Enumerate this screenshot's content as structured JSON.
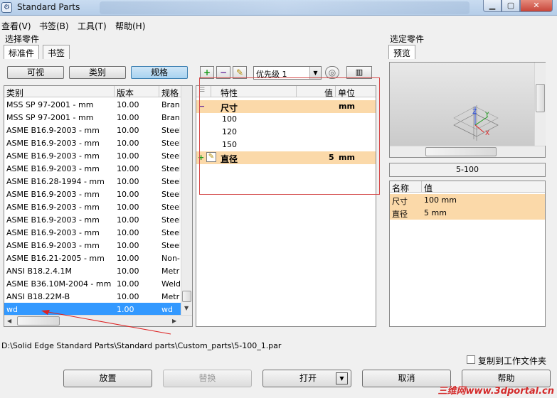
{
  "window": {
    "title": "Standard Parts",
    "controls": {
      "minimize": "▁",
      "maximize": "▢",
      "close": "✕"
    }
  },
  "menu": [
    "查看(V)",
    "书签(B)",
    "工具(T)",
    "帮助(H)"
  ],
  "left": {
    "section_label": "选择零件",
    "tabs": [
      "标准件",
      "书签"
    ],
    "filter_buttons": [
      "可视",
      "类别",
      "规格"
    ],
    "columns": [
      "类别",
      "版本",
      "规格"
    ],
    "rows": [
      [
        "MSS SP 97-2001 - mm",
        "10.00",
        "Branc"
      ],
      [
        "MSS SP 97-2001 - mm",
        "10.00",
        "Branc"
      ],
      [
        "ASME B16.9-2003 - mm",
        "10.00",
        "Steel"
      ],
      [
        "ASME B16.9-2003 - mm",
        "10.00",
        "Steel"
      ],
      [
        "ASME B16.9-2003 - mm",
        "10.00",
        "Steel"
      ],
      [
        "ASME B16.9-2003 - mm",
        "10.00",
        "Steel"
      ],
      [
        "ASME B16.28-1994 - mm",
        "10.00",
        "Steel"
      ],
      [
        "ASME B16.9-2003 - mm",
        "10.00",
        "Steel"
      ],
      [
        "ASME B16.9-2003 - mm",
        "10.00",
        "Steel"
      ],
      [
        "ASME B16.9-2003 - mm",
        "10.00",
        "Steel"
      ],
      [
        "ASME B16.9-2003 - mm",
        "10.00",
        "Steel"
      ],
      [
        "ASME B16.9-2003 - mm",
        "10.00",
        "Steel"
      ],
      [
        "ASME B16.21-2005 - mm",
        "10.00",
        "Non-"
      ],
      [
        "ANSI B18.2.4.1M",
        "10.00",
        "Metri"
      ],
      [
        "ASME B36.10M-2004 - mm",
        "10.00",
        "Weld"
      ],
      [
        "ANSI B18.22M-B",
        "10.00",
        "Metri"
      ]
    ],
    "selected_row": [
      "wd",
      "1.00",
      "wd"
    ]
  },
  "middle": {
    "priority_select": "优先级 1",
    "columns": [
      "特性",
      "值",
      "单位"
    ],
    "groups": [
      {
        "name": "尺寸",
        "value": "",
        "unit": "mm",
        "values": [
          "100",
          "120",
          "150"
        ]
      },
      {
        "name": "直径",
        "value": "5",
        "unit": "mm",
        "values": []
      }
    ]
  },
  "right": {
    "section_label": "选定零件",
    "preview_tab": "预览",
    "part_name": "5-100",
    "columns": [
      "名称",
      "值"
    ],
    "props": [
      {
        "name": "尺寸",
        "value": "100 mm"
      },
      {
        "name": "直径",
        "value": "5 mm"
      }
    ]
  },
  "path": "D:\\Solid Edge Standard Parts\\Standard parts\\Custom_parts\\5-100_1.par",
  "copy_checkbox_label": "复制到工作文件夹",
  "buttons": {
    "place": "放置",
    "replace": "替换",
    "open": "打开",
    "cancel": "取消",
    "help": "帮助"
  },
  "watermark": "三维网www.3dportal.cn"
}
